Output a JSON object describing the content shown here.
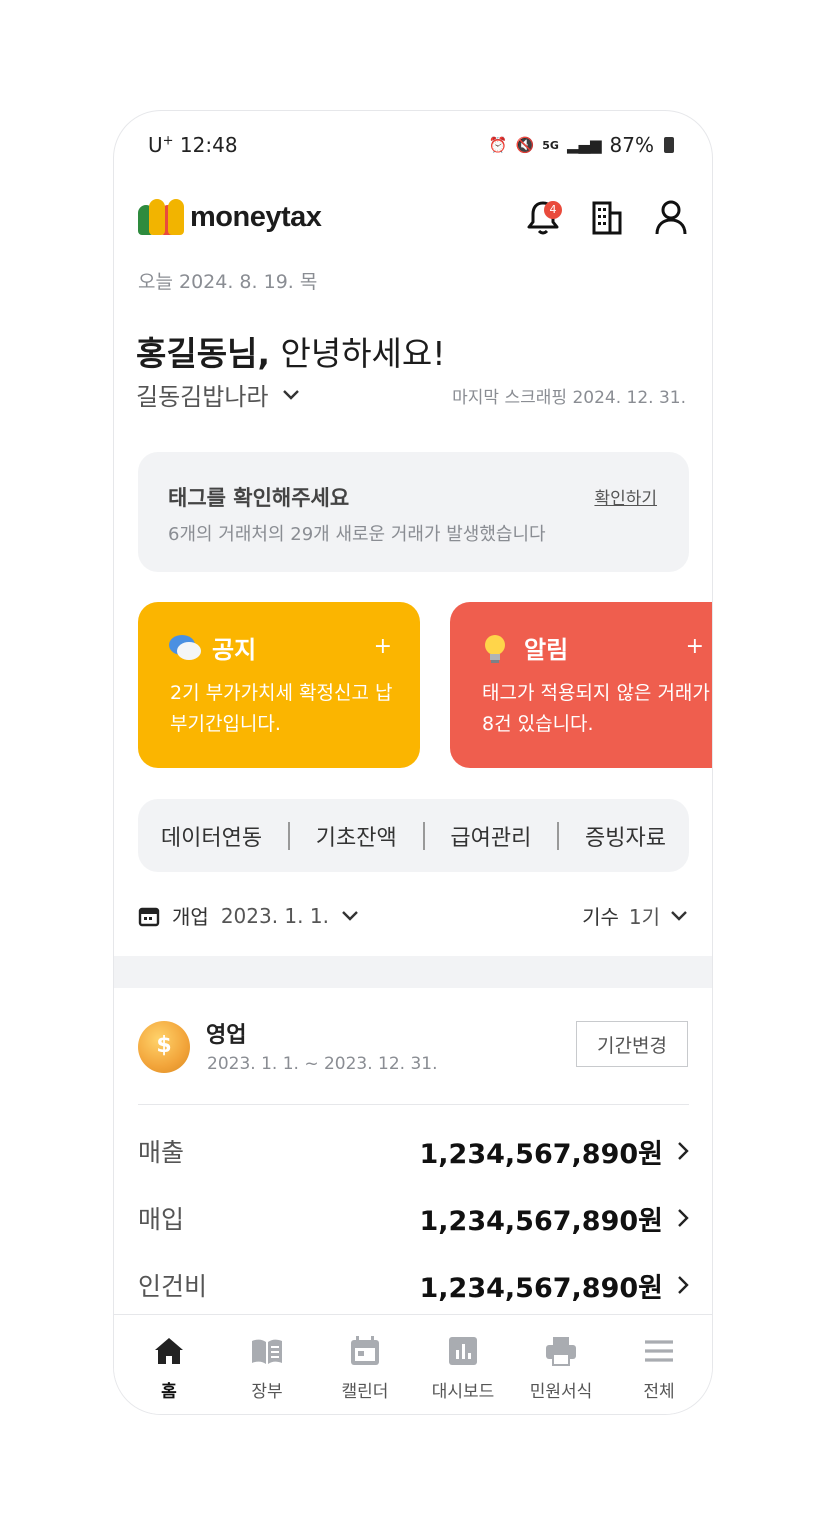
{
  "status_bar": {
    "carrier": "U",
    "carrier_sup": "+",
    "time": "12:48",
    "network": "5G",
    "battery": "87%"
  },
  "header": {
    "logo_text": "moneytax",
    "notification_count": "4"
  },
  "today": "오늘 2024. 8. 19. 목",
  "greeting": {
    "name": "홍길동님,",
    "message": " 안녕하세요!"
  },
  "store": "길동김밥나라",
  "last_scrape": "마지막 스크래핑 2024. 12. 31.",
  "tag_card": {
    "title": "태그를 확인해주세요",
    "link": "확인하기",
    "description": "6개의 거래처의 29개 새로운 거래가 발생했습니다"
  },
  "notice_card": {
    "title": "공지",
    "plus": "+",
    "body": "2기 부가가치세 확정신고 납부기간입니다."
  },
  "alert_card": {
    "title": "알림",
    "plus": "+",
    "body": "태그가 적용되지 않은 거래가 8건 있습니다."
  },
  "menu": [
    "데이터연동",
    "기초잔액",
    "급여관리",
    "증빙자료"
  ],
  "period": {
    "label": "개업",
    "value": "2023. 1. 1.",
    "term_label": "기수",
    "term_value": "1기"
  },
  "sales_section": {
    "title": "영업",
    "range": "2023. 1. 1. ~ 2023. 12. 31.",
    "change_button": "기간변경",
    "rows": [
      {
        "label": "매출",
        "value": "1,234,567,890원"
      },
      {
        "label": "매입",
        "value": "1,234,567,890원"
      },
      {
        "label": "인건비",
        "value": "1,234,567,890원"
      }
    ]
  },
  "bottom_nav": [
    {
      "label": "홈",
      "icon": "home-icon"
    },
    {
      "label": "장부",
      "icon": "book-icon"
    },
    {
      "label": "캘린더",
      "icon": "calendar-icon"
    },
    {
      "label": "대시보드",
      "icon": "dashboard-icon"
    },
    {
      "label": "민원서식",
      "icon": "printer-icon"
    },
    {
      "label": "전체",
      "icon": "menu-icon"
    }
  ],
  "colors": {
    "notice": "#fbb500",
    "alert": "#ef5e4e",
    "card_bg": "#f2f3f5"
  }
}
